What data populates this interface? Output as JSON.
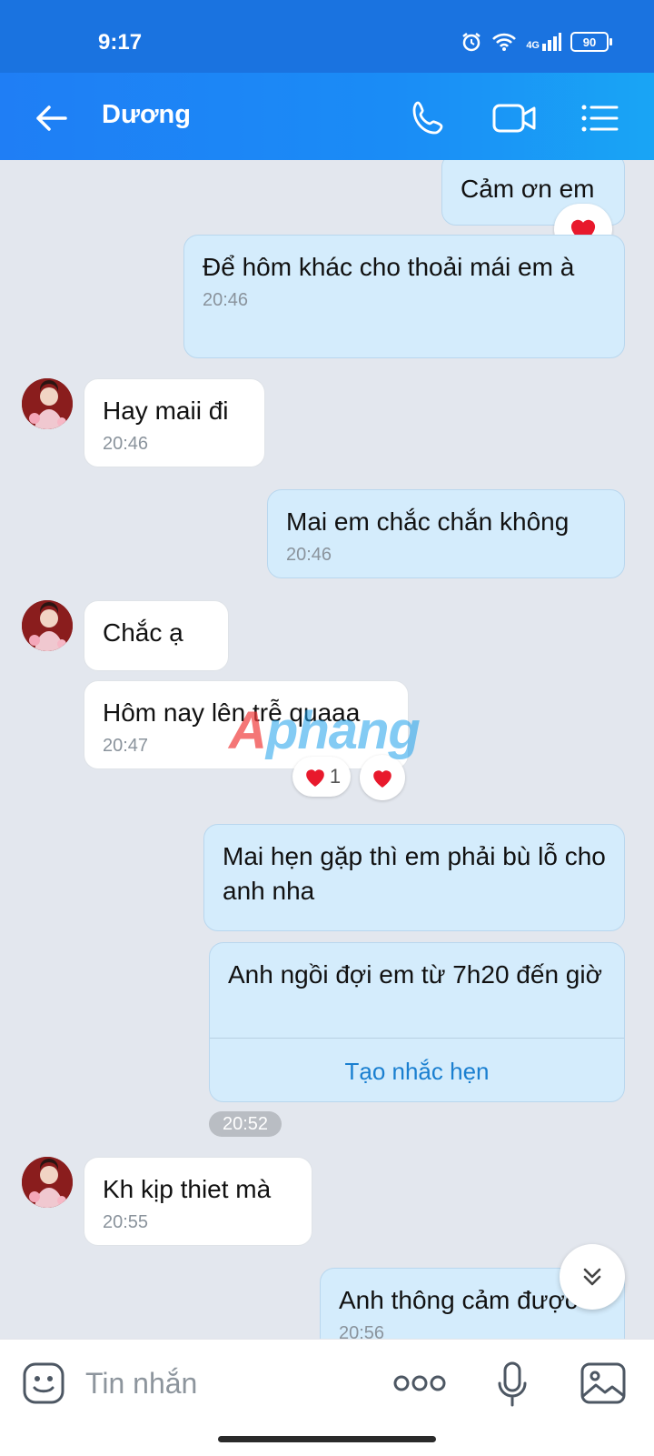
{
  "status": {
    "time": "9:17",
    "battery": "90",
    "network": "4G"
  },
  "header": {
    "contact_name": "Dương"
  },
  "messages": [
    {
      "text": "Cảm ơn em"
    },
    {
      "text": "Để hôm khác cho thoải mái em à",
      "time": "20:46"
    },
    {
      "text": "Hay maii đi",
      "time": "20:46"
    },
    {
      "text": "Mai em chắc chắn không",
      "time": "20:46"
    },
    {
      "text": "Chắc ạ"
    },
    {
      "text": "Hôm nay lên trễ quaaa",
      "time": "20:47"
    },
    {
      "text": "Mai hẹn gặp thì em phải bù lỗ cho anh nha"
    },
    {
      "text": "Anh ngồi đợi em từ 7h20 đến giờ",
      "action": "Tạo nhắc hẹn"
    },
    {
      "text": "Kh kịp thiet mà",
      "time": "20:55"
    },
    {
      "text": "Anh thông cảm được",
      "time": "20:56"
    }
  ],
  "group_time": "20:52",
  "reactions": {
    "count": "1"
  },
  "watermark": {
    "part1": "A",
    "part2": "phang"
  },
  "input": {
    "placeholder": "Tin nhắn"
  },
  "colors": {
    "header": "#1f7ef5",
    "outgoing_bubble": "#d4ecfc",
    "incoming_bubble": "#ffffff",
    "chat_bg": "#e3e7ee",
    "heart": "#e8192c"
  },
  "icons": [
    "back-arrow-icon",
    "phone-icon",
    "video-call-icon",
    "menu-icon",
    "heart-icon",
    "chevron-double-down-icon",
    "emoji-sticker-icon",
    "more-dots-icon",
    "microphone-icon",
    "image-icon",
    "alarm-icon",
    "wifi-icon",
    "signal-icon",
    "battery-icon"
  ]
}
